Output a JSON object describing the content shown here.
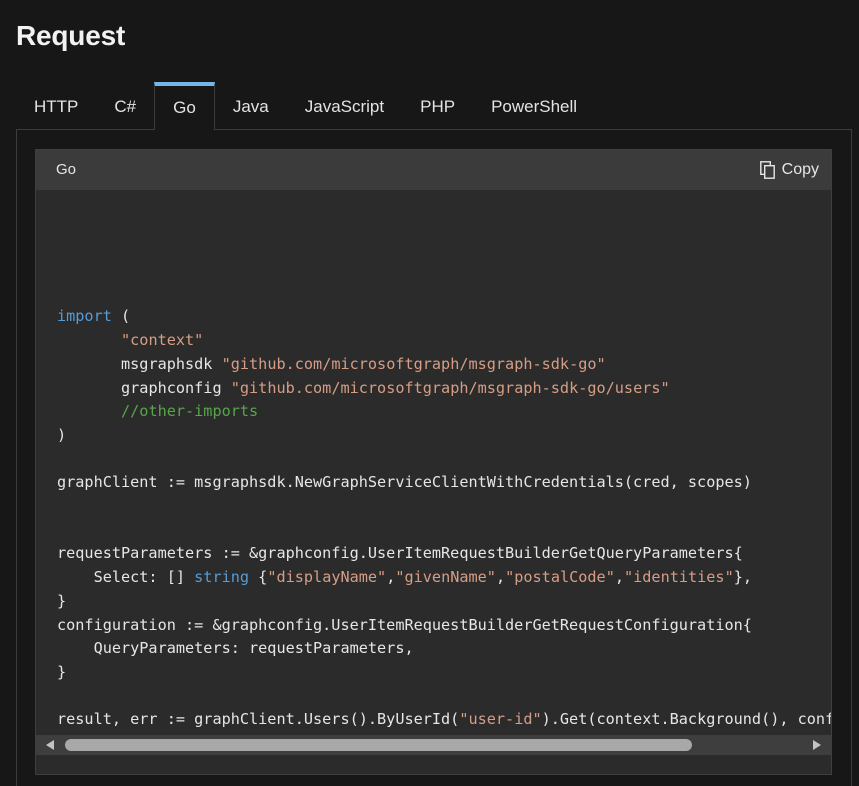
{
  "page": {
    "heading": "Request"
  },
  "tabs": [
    {
      "label": "HTTP",
      "active": false
    },
    {
      "label": "C#",
      "active": false
    },
    {
      "label": "Go",
      "active": true
    },
    {
      "label": "Java",
      "active": false
    },
    {
      "label": "JavaScript",
      "active": false
    },
    {
      "label": "PHP",
      "active": false
    },
    {
      "label": "PowerShell",
      "active": false
    }
  ],
  "code_block": {
    "language": "Go",
    "copy_label": "Copy",
    "copy_icon": "copy-icon",
    "lines": [
      "",
      "",
      "import (",
      "\t\"context\"",
      "\tmsgraphsdk \"github.com/microsoftgraph/msgraph-sdk-go\"",
      "\tgraphconfig \"github.com/microsoftgraph/msgraph-sdk-go/users\"",
      "\t//other-imports",
      ")",
      "",
      "graphClient := msgraphsdk.NewGraphServiceClientWithCredentials(cred, scopes)",
      "",
      "",
      "requestParameters := &graphconfig.UserItemRequestBuilderGetQueryParameters{",
      "    Select: [] string {\"displayName\",\"givenName\",\"postalCode\",\"identities\"},",
      "}",
      "configuration := &graphconfig.UserItemRequestBuilderGetRequestConfiguration{",
      "    QueryParameters: requestParameters,",
      "}",
      "",
      "result, err := graphClient.Users().ByUserId(\"user-id\").Get(context.Background(), configuration)"
    ]
  },
  "colors": {
    "background": "#171717",
    "code_background": "#2b2b2b",
    "code_header": "#3b3b3b",
    "tab_accent": "#75b6e7",
    "keyword": "#569cd6",
    "string": "#d69d85",
    "comment": "#57a64a"
  }
}
